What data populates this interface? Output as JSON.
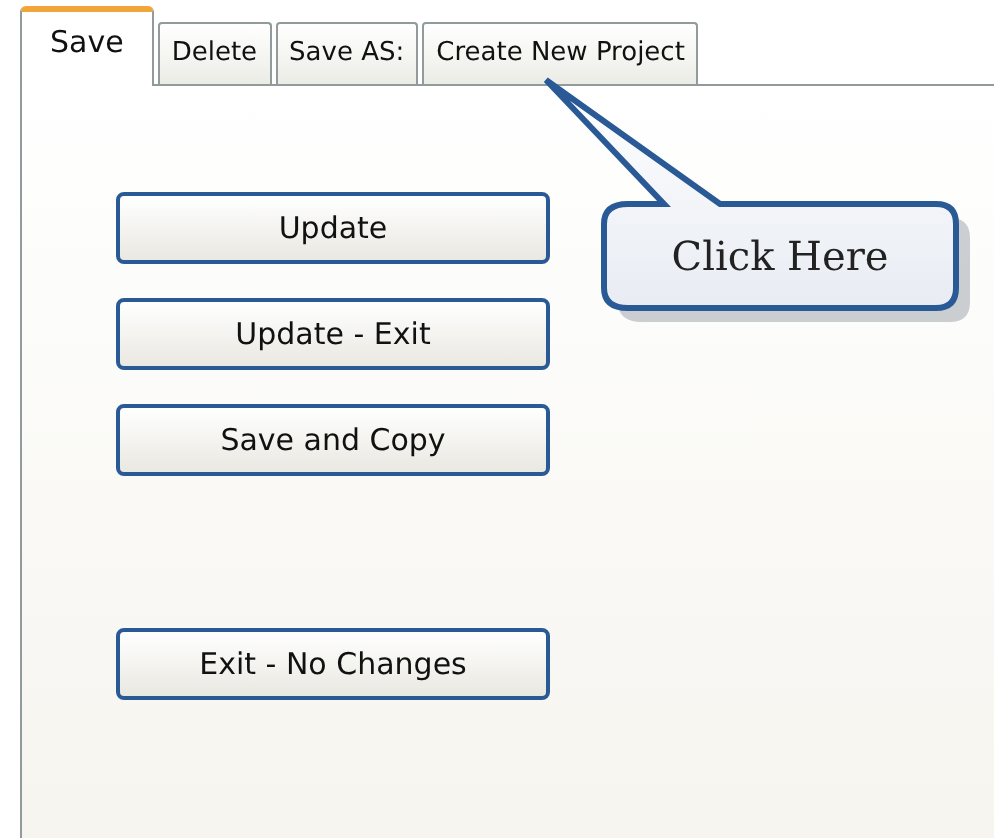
{
  "tabs": [
    {
      "label": "Save",
      "selected": true
    },
    {
      "label": "Delete",
      "selected": false
    },
    {
      "label": "Save AS:",
      "selected": false
    },
    {
      "label": "Create New Project",
      "selected": false
    }
  ],
  "button_groups": [
    [
      {
        "label": "Update"
      },
      {
        "label": "Update - Exit"
      },
      {
        "label": "Save and Copy"
      }
    ],
    [
      {
        "label": "Exit - No Changes"
      }
    ]
  ],
  "callout": {
    "text": "Click Here"
  }
}
